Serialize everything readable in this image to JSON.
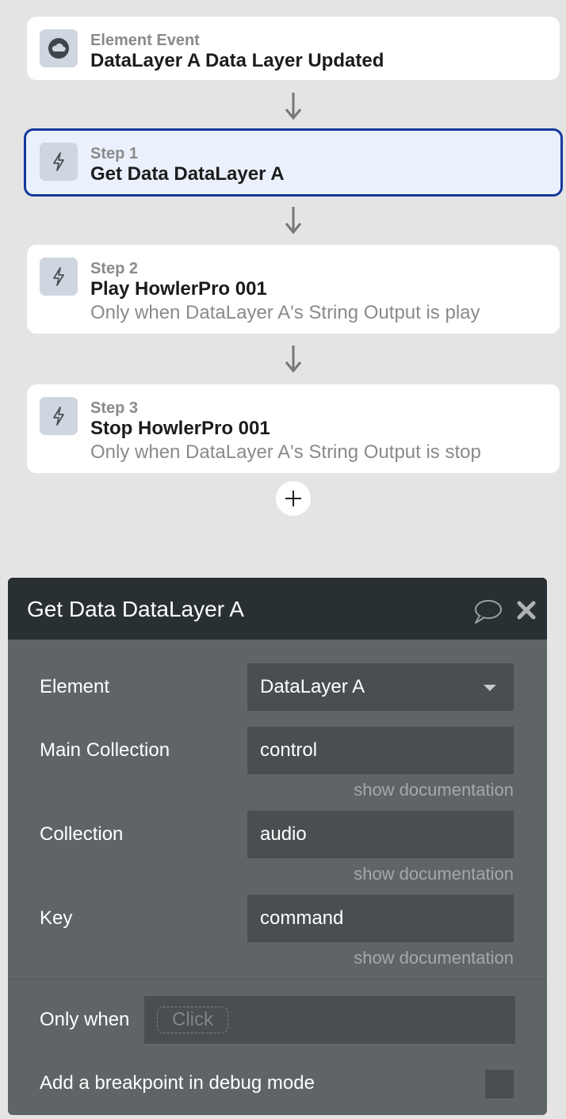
{
  "workflow": {
    "event": {
      "subtitle": "Element Event",
      "title": "DataLayer A Data Layer Updated",
      "icon": "cloud-icon"
    },
    "steps": [
      {
        "subtitle": "Step 1",
        "title": "Get Data DataLayer A",
        "condition": "",
        "icon": "lightning-icon",
        "selected": true
      },
      {
        "subtitle": "Step 2",
        "title": "Play HowlerPro 001",
        "condition": "Only when DataLayer A's String Output is play",
        "icon": "lightning-icon",
        "selected": false
      },
      {
        "subtitle": "Step 3",
        "title": "Stop HowlerPro 001",
        "condition": "Only when DataLayer A's String Output is stop",
        "icon": "lightning-icon",
        "selected": false
      }
    ],
    "add_step_icon": "plus-icon"
  },
  "panel": {
    "title": "Get Data DataLayer A",
    "comment_icon": "comment-bubble-icon",
    "close_icon": "close-icon",
    "fields": {
      "element": {
        "label": "Element",
        "value": "DataLayer A"
      },
      "main_collection": {
        "label": "Main Collection",
        "value": "control",
        "doc_link": "show documentation"
      },
      "collection": {
        "label": "Collection",
        "value": "audio",
        "doc_link": "show documentation"
      },
      "key": {
        "label": "Key",
        "value": "command",
        "doc_link": "show documentation"
      }
    },
    "only_when": {
      "label": "Only when",
      "placeholder": "Click"
    },
    "breakpoint": {
      "label": "Add a breakpoint in debug mode",
      "checked": false
    }
  },
  "colors": {
    "canvas_bg": "#e4e4e4",
    "selected_border": "#14389c",
    "selected_bg": "#eaf1fd",
    "panel_bg": "#5f6467",
    "panel_header_bg": "#293033",
    "field_bg": "#4a4e51"
  }
}
